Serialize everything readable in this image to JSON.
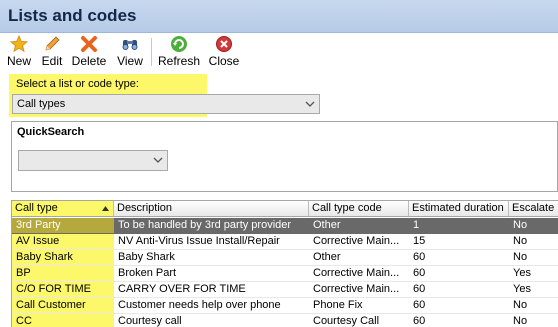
{
  "window": {
    "title": "Lists and codes"
  },
  "toolbar": {
    "new_label": "New",
    "edit_label": "Edit",
    "delete_label": "Delete",
    "view_label": "View",
    "refresh_label": "Refresh",
    "close_label": "Close"
  },
  "list_selector": {
    "label": "Select a list or code type:",
    "value": "Call types"
  },
  "quicksearch": {
    "title": "QuickSearch",
    "value": ""
  },
  "grid": {
    "columns": [
      "Call type",
      "Description",
      "Call type code",
      "Estimated duration",
      "Escalate"
    ],
    "rows": [
      {
        "call_type": "3rd Party",
        "description": "To be handled by 3rd party provider",
        "code": "Other",
        "duration": "1",
        "escalate": "No"
      },
      {
        "call_type": "AV Issue",
        "description": "NV Anti-Virus Issue Install/Repair",
        "code": "Corrective Main...",
        "duration": "15",
        "escalate": "No"
      },
      {
        "call_type": "Baby Shark",
        "description": "Baby Shark",
        "code": "Other",
        "duration": "60",
        "escalate": "No"
      },
      {
        "call_type": "BP",
        "description": "Broken Part",
        "code": "Corrective Main...",
        "duration": "60",
        "escalate": "Yes"
      },
      {
        "call_type": "C/O FOR TIME",
        "description": "CARRY OVER FOR TIME",
        "code": "Corrective Main...",
        "duration": "60",
        "escalate": "Yes"
      },
      {
        "call_type": "Call Customer",
        "description": "Customer needs help over phone",
        "code": "Phone Fix",
        "duration": "60",
        "escalate": "No"
      },
      {
        "call_type": "CC",
        "description": "Courtesy call",
        "code": "Courtesy Call",
        "duration": "60",
        "escalate": "No"
      }
    ]
  },
  "colors": {
    "highlight": "#fcf86a",
    "title_bar": "#b6cbe7",
    "selected_row": "#696969"
  },
  "icons": [
    "star-icon",
    "pencil-icon",
    "delete-x-icon",
    "binoculars-icon",
    "refresh-icon",
    "close-icon"
  ]
}
